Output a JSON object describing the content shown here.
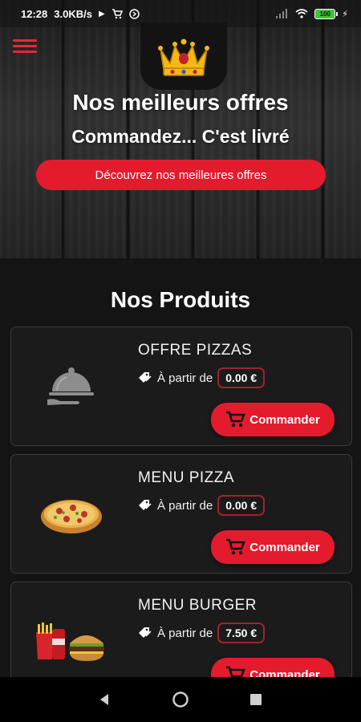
{
  "status_bar": {
    "time": "12:28",
    "network_speed": "3.0KB/s",
    "battery_level": "100",
    "icons": [
      "play-icon",
      "cart-icon",
      "shazam-icon",
      "signal-icon",
      "wifi-icon",
      "battery-icon",
      "charging-icon"
    ]
  },
  "header": {
    "menu_icon": "hamburger-menu-icon",
    "logo_icon": "crown-logo-icon",
    "title": "Nos meilleurs offres",
    "subtitle": "Commandez... C'est livré",
    "offers_button_label": "Découvrez nos meilleures offres"
  },
  "products_section": {
    "title": "Nos Produits",
    "price_prefix": "À partir de",
    "order_button_label": "Commander",
    "items": [
      {
        "name": "OFFRE PIZZAS",
        "price": "0.00 €",
        "image_icon": "cloche-serving-icon"
      },
      {
        "name": "MENU PIZZA",
        "price": "0.00 €",
        "image_icon": "pizza-image"
      },
      {
        "name": "MENU BURGER",
        "price": "7.50 €",
        "image_icon": "burger-menu-image"
      }
    ]
  },
  "nav_bar": {
    "icons": [
      "back-icon",
      "home-icon",
      "recents-icon"
    ]
  },
  "colors": {
    "accent": "#e41b2d",
    "background": "#141414",
    "card": "#1b1b1b",
    "price_border": "#a3222e"
  }
}
